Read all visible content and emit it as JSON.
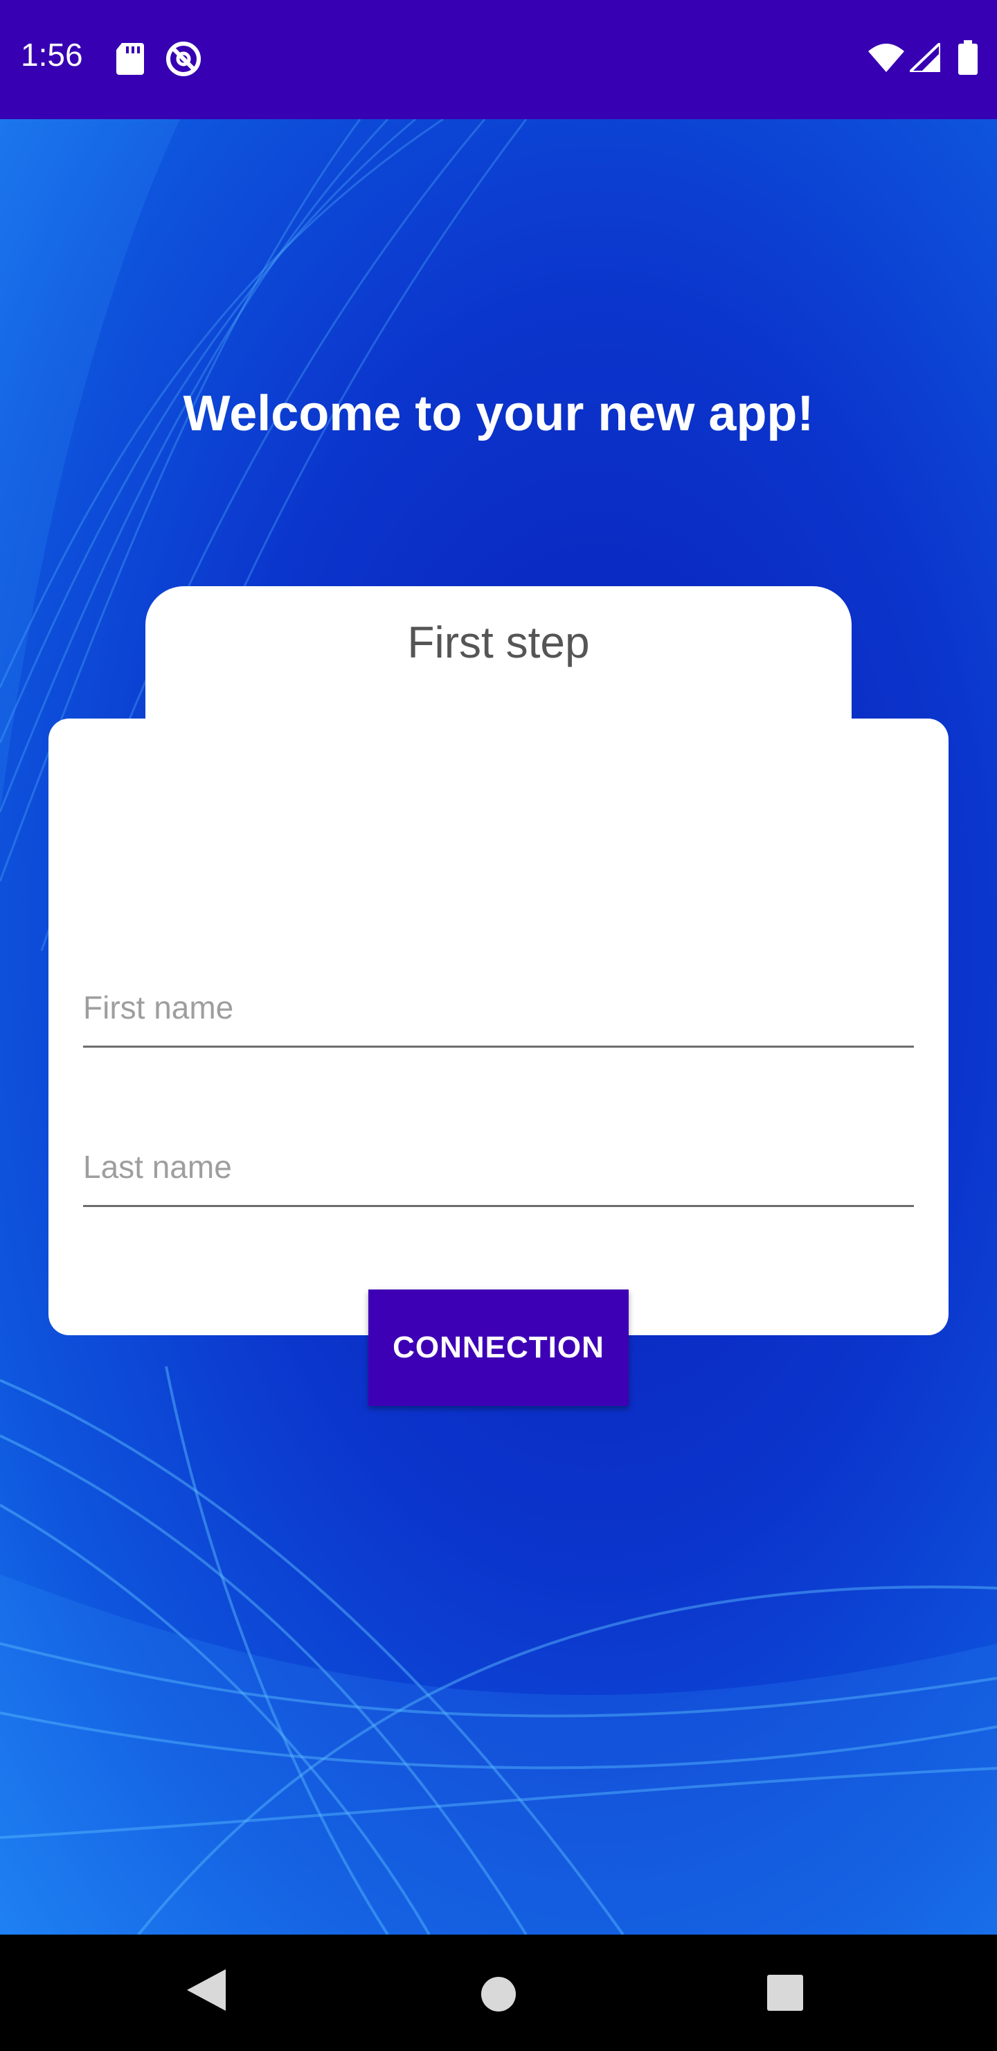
{
  "status_bar": {
    "time": "1:56",
    "icons": [
      "sd-card-icon",
      "sync-disabled-icon",
      "wifi-icon",
      "signal-icon",
      "battery-icon"
    ],
    "background": "#3700b3"
  },
  "screen": {
    "welcome_title": "Welcome to your new app!",
    "card": {
      "tab_label": "First step",
      "first_name_placeholder": "First name",
      "last_name_placeholder": "Last name",
      "first_name_value": "",
      "last_name_value": "",
      "connect_label": "CONNECTION",
      "button_color": "#3d00b5"
    }
  },
  "nav_bar": {
    "icons": [
      "back-icon",
      "home-icon",
      "recents-icon"
    ]
  }
}
